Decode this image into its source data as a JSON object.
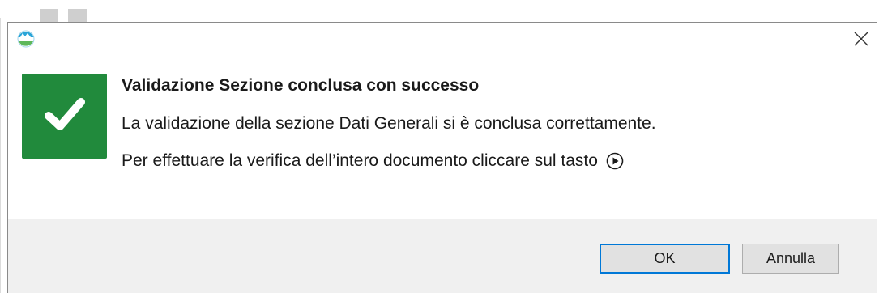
{
  "dialog": {
    "title": "Validazione Sezione conclusa con successo",
    "message_line1": "La validazione della sezione Dati Generali si è conclusa correttamente.",
    "message_line2": "Per effettuare la verifica dell’intero documento cliccare sul tasto",
    "status_icon": "check-icon",
    "status_color": "#218a3c",
    "inline_icon": "play-circle-icon"
  },
  "buttons": {
    "ok_label": "OK",
    "cancel_label": "Annulla"
  },
  "colors": {
    "accent": "#0078d7",
    "footer_bg": "#f0f0f0"
  }
}
